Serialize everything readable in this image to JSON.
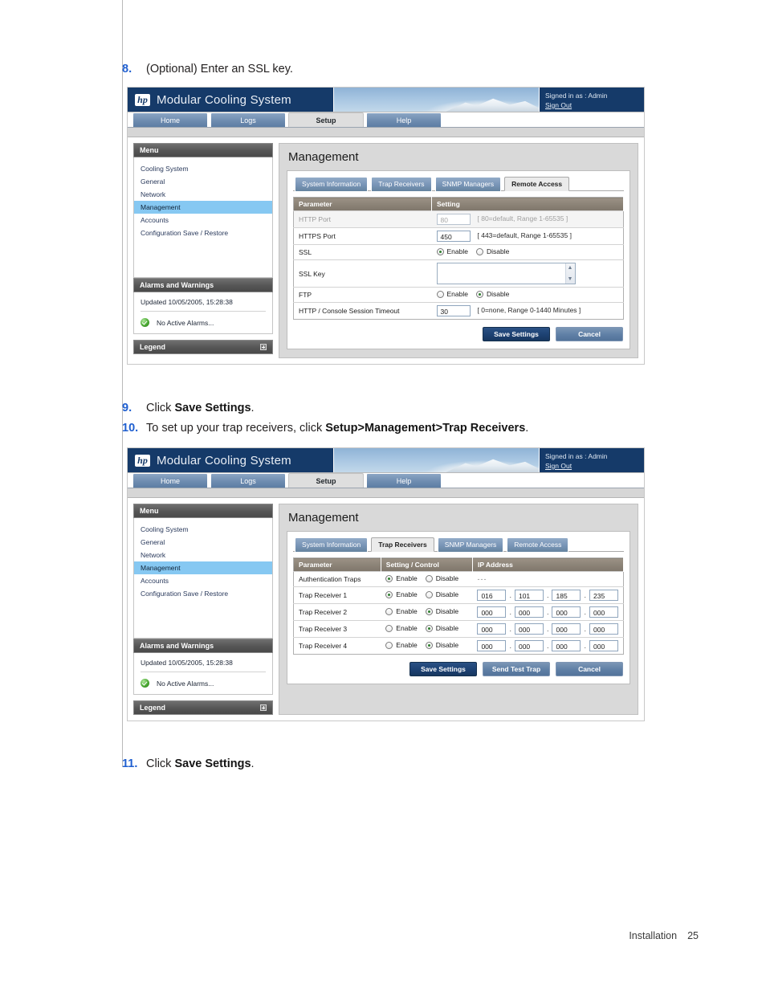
{
  "document": {
    "footer_label": "Installation",
    "page_number": "25"
  },
  "steps": [
    {
      "num": "8.",
      "pre": "(Optional) Enter an SSL key.",
      "bold": "",
      "post": ""
    },
    {
      "num": "9.",
      "pre": "Click ",
      "bold": "Save Settings",
      "post": "."
    },
    {
      "num": "10.",
      "pre": "To set up your trap receivers, click ",
      "bold": "Setup>Management>Trap Receivers",
      "post": "."
    },
    {
      "num": "11.",
      "pre": "Click ",
      "bold": "Save Settings",
      "post": "."
    }
  ],
  "app": {
    "brand_title": "Modular Cooling System",
    "hp_logo": "hp-logo",
    "signed_in": "Signed in as : Admin",
    "sign_out": "Sign Out",
    "nav_tabs": [
      {
        "label": "Home",
        "active": false
      },
      {
        "label": "Logs",
        "active": false
      },
      {
        "label": "Setup",
        "active": true
      },
      {
        "label": "Help",
        "active": false
      }
    ],
    "sidebar": {
      "menu_title": "Menu",
      "menu_items": [
        {
          "label": "Cooling System",
          "selected": false
        },
        {
          "label": "General",
          "selected": false
        },
        {
          "label": "Network",
          "selected": false
        },
        {
          "label": "Management",
          "selected": true
        },
        {
          "label": "Accounts",
          "selected": false
        },
        {
          "label": "Configuration Save / Restore",
          "selected": false
        }
      ],
      "alarms_title": "Alarms and Warnings",
      "updated": "Updated 10/05/2005, 15:28:38",
      "alarm_status": "No Active Alarms...",
      "legend_title": "Legend"
    },
    "content_title": "Management",
    "sub_tabs": [
      "System Information",
      "Trap Receivers",
      "SNMP Managers",
      "Remote Access"
    ]
  },
  "screen_remote_access": {
    "active_tab": "Remote Access",
    "columns": [
      "Parameter",
      "Setting"
    ],
    "rows": [
      {
        "parameter": "HTTP Port",
        "value": "80",
        "hint": "[ 80=default, Range 1-65535 ]",
        "disabled": true
      },
      {
        "parameter": "HTTPS Port",
        "value": "450",
        "hint": "[ 443=default, Range 1-65535 ]",
        "disabled": false
      },
      {
        "parameter": "SSL",
        "enable_label": "Enable",
        "disable_label": "Disable",
        "selected": "Enable"
      },
      {
        "parameter": "SSL Key",
        "value": ""
      },
      {
        "parameter": "FTP",
        "enable_label": "Enable",
        "disable_label": "Disable",
        "selected": "Disable"
      },
      {
        "parameter": "HTTP / Console Session Timeout",
        "value": "30",
        "hint": "[ 0=none, Range 0-1440 Minutes ]",
        "disabled": false
      }
    ],
    "buttons": [
      {
        "label": "Save Settings",
        "primary": true
      },
      {
        "label": "Cancel",
        "primary": false
      }
    ]
  },
  "screen_trap_receivers": {
    "active_tab": "Trap Receivers",
    "columns": [
      "Parameter",
      "Setting / Control",
      "IP Address"
    ],
    "rows": [
      {
        "parameter": "Authentication Traps",
        "enable_label": "Enable",
        "disable_label": "Disable",
        "selected": "Enable",
        "ip": null,
        "ip_placeholder": "---"
      },
      {
        "parameter": "Trap Receiver 1",
        "enable_label": "Enable",
        "disable_label": "Disable",
        "selected": "Enable",
        "ip": [
          "016",
          "101",
          "185",
          "235"
        ]
      },
      {
        "parameter": "Trap Receiver 2",
        "enable_label": "Enable",
        "disable_label": "Disable",
        "selected": "Disable",
        "ip": [
          "000",
          "000",
          "000",
          "000"
        ]
      },
      {
        "parameter": "Trap Receiver 3",
        "enable_label": "Enable",
        "disable_label": "Disable",
        "selected": "Disable",
        "ip": [
          "000",
          "000",
          "000",
          "000"
        ]
      },
      {
        "parameter": "Trap Receiver 4",
        "enable_label": "Enable",
        "disable_label": "Disable",
        "selected": "Disable",
        "ip": [
          "000",
          "000",
          "000",
          "000"
        ]
      }
    ],
    "buttons": [
      {
        "label": "Save Settings",
        "primary": true
      },
      {
        "label": "Send Test Trap",
        "primary": false
      },
      {
        "label": "Cancel",
        "primary": false
      }
    ]
  },
  "colors": {
    "brand_navy": "#153a69",
    "selected_menu": "#86c8f2",
    "table_header": "#8b8276",
    "primary_button": "#1d4172",
    "step_number": "#1f5fd0",
    "ok_green": "#4aa832"
  }
}
